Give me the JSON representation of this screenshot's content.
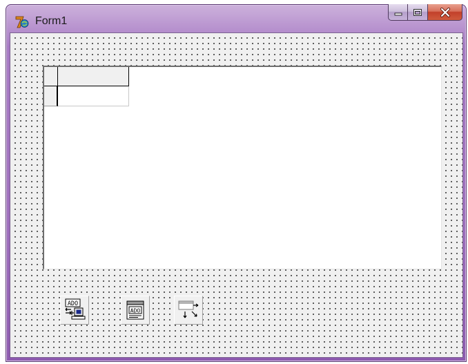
{
  "window": {
    "title": "Form1"
  },
  "components": {
    "ado_connection": {
      "label": "ADO"
    },
    "ado_dataset": {
      "label": "ADO"
    }
  },
  "colors": {
    "frame": "#9f6fbd",
    "client": "#f0f0f0",
    "close_button": "#c2402a"
  }
}
